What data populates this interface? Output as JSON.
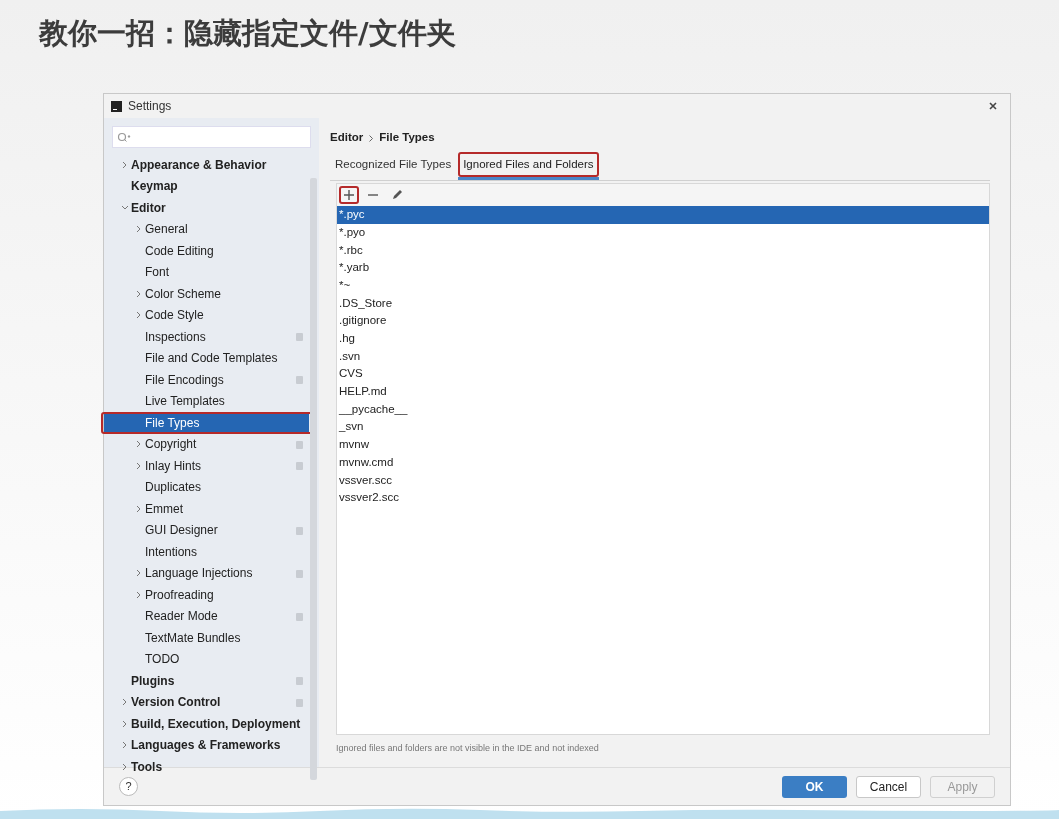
{
  "slide_title": "教你一招：隐藏指定文件/文件夹",
  "window": {
    "title": "Settings"
  },
  "sidebar": {
    "items": [
      {
        "label": "Appearance & Behavior",
        "expanded": false,
        "selected": false,
        "project": false,
        "highlighted": false
      },
      {
        "label": "Keymap",
        "selected": false,
        "project": false,
        "highlighted": false
      },
      {
        "label": "Editor",
        "expanded": true,
        "selected": false,
        "project": false,
        "highlighted": false,
        "children": [
          {
            "label": "General",
            "expanded": false,
            "selected": false,
            "project": false,
            "highlighted": false
          },
          {
            "label": "Code Editing",
            "selected": false,
            "project": false,
            "highlighted": false
          },
          {
            "label": "Font",
            "selected": false,
            "project": false,
            "highlighted": false
          },
          {
            "label": "Color Scheme",
            "expanded": false,
            "selected": false,
            "project": false,
            "highlighted": false
          },
          {
            "label": "Code Style",
            "expanded": false,
            "selected": false,
            "project": false,
            "highlighted": false
          },
          {
            "label": "Inspections",
            "selected": false,
            "project": true,
            "highlighted": false
          },
          {
            "label": "File and Code Templates",
            "selected": false,
            "project": false,
            "highlighted": false
          },
          {
            "label": "File Encodings",
            "selected": false,
            "project": true,
            "highlighted": false
          },
          {
            "label": "Live Templates",
            "selected": false,
            "project": false,
            "highlighted": false
          },
          {
            "label": "File Types",
            "selected": true,
            "project": false,
            "highlighted": true
          },
          {
            "label": "Copyright",
            "expanded": false,
            "selected": false,
            "project": true,
            "highlighted": false
          },
          {
            "label": "Inlay Hints",
            "expanded": false,
            "selected": false,
            "project": true,
            "highlighted": false
          },
          {
            "label": "Duplicates",
            "selected": false,
            "project": false,
            "highlighted": false
          },
          {
            "label": "Emmet",
            "expanded": false,
            "selected": false,
            "project": false,
            "highlighted": false
          },
          {
            "label": "GUI Designer",
            "selected": false,
            "project": true,
            "highlighted": false
          },
          {
            "label": "Intentions",
            "selected": false,
            "project": false,
            "highlighted": false
          },
          {
            "label": "Language Injections",
            "expanded": false,
            "selected": false,
            "project": true,
            "highlighted": false
          },
          {
            "label": "Proofreading",
            "expanded": false,
            "selected": false,
            "project": false,
            "highlighted": false
          },
          {
            "label": "Reader Mode",
            "selected": false,
            "project": true,
            "highlighted": false
          },
          {
            "label": "TextMate Bundles",
            "selected": false,
            "project": false,
            "highlighted": false
          },
          {
            "label": "TODO",
            "selected": false,
            "project": false,
            "highlighted": false
          }
        ]
      },
      {
        "label": "Plugins",
        "selected": false,
        "project": true,
        "highlighted": false
      },
      {
        "label": "Version Control",
        "expanded": false,
        "selected": false,
        "project": true,
        "highlighted": false
      },
      {
        "label": "Build, Execution, Deployment",
        "expanded": false,
        "selected": false,
        "project": false,
        "highlighted": false
      },
      {
        "label": "Languages & Frameworks",
        "expanded": false,
        "selected": false,
        "project": false,
        "highlighted": false
      },
      {
        "label": "Tools",
        "expanded": false,
        "selected": false,
        "project": false,
        "highlighted": false
      }
    ]
  },
  "breadcrumb": [
    "Editor",
    "File Types"
  ],
  "tabs": [
    {
      "label": "Recognized File Types",
      "selected": false,
      "highlighted": false
    },
    {
      "label": "Ignored Files and Folders",
      "selected": true,
      "highlighted": true
    }
  ],
  "toolbar": [
    {
      "kind": "add",
      "highlighted": true
    },
    {
      "kind": "remove",
      "highlighted": false
    },
    {
      "kind": "edit",
      "highlighted": false
    }
  ],
  "files": [
    {
      "name": "*.pyc",
      "selected": true
    },
    {
      "name": "*.pyo",
      "selected": false
    },
    {
      "name": "*.rbc",
      "selected": false
    },
    {
      "name": "*.yarb",
      "selected": false
    },
    {
      "name": "*~",
      "selected": false
    },
    {
      "name": ".DS_Store",
      "selected": false
    },
    {
      "name": ".gitignore",
      "selected": false
    },
    {
      "name": ".hg",
      "selected": false
    },
    {
      "name": ".svn",
      "selected": false
    },
    {
      "name": "CVS",
      "selected": false
    },
    {
      "name": "HELP.md",
      "selected": false
    },
    {
      "name": "__pycache__",
      "selected": false
    },
    {
      "name": "_svn",
      "selected": false
    },
    {
      "name": "mvnw",
      "selected": false
    },
    {
      "name": "mvnw.cmd",
      "selected": false
    },
    {
      "name": "vssver.scc",
      "selected": false
    },
    {
      "name": "vssver2.scc",
      "selected": false
    }
  ],
  "hint": "Ignored files and folders are not visible in the IDE and not indexed",
  "help": "?",
  "buttons": [
    {
      "label": "OK",
      "kind": "primary",
      "disabled": false
    },
    {
      "label": "Cancel",
      "kind": "normal",
      "disabled": false
    },
    {
      "label": "Apply",
      "kind": "normal",
      "disabled": true
    }
  ]
}
